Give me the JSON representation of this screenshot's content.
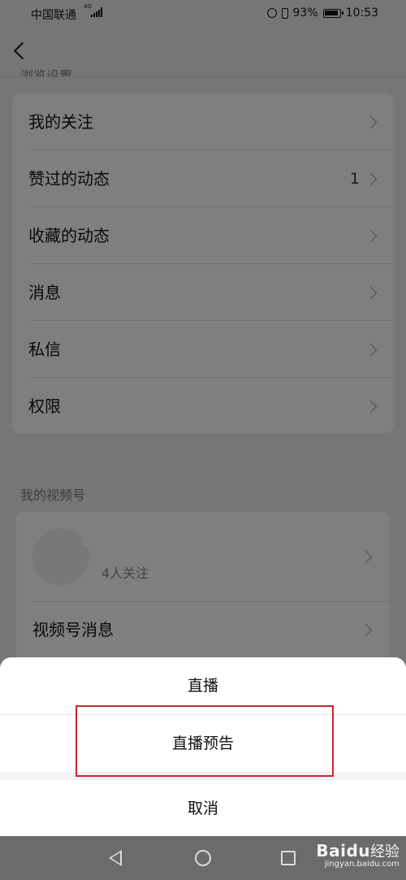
{
  "status_bar": {
    "carrier": "中国联通",
    "network": "4G",
    "battery": "93%",
    "time": "10:53"
  },
  "page": {
    "section_browse_title": "浏览设置",
    "menu": [
      {
        "label": "我的关注"
      },
      {
        "label": "赞过的动态",
        "count": "1"
      },
      {
        "label": "收藏的动态"
      },
      {
        "label": "消息"
      },
      {
        "label": "私信"
      },
      {
        "label": "权限"
      }
    ],
    "section_channel_title": "我的视频号",
    "channel": {
      "followers": "4人关注",
      "messages_label": "视频号消息"
    }
  },
  "action_sheet": {
    "option_live": "直播",
    "option_preview": "直播预告",
    "cancel": "取消"
  },
  "watermark": {
    "logo": "Baidu",
    "cn": "经验",
    "url": "jingyan.baidu.com"
  }
}
